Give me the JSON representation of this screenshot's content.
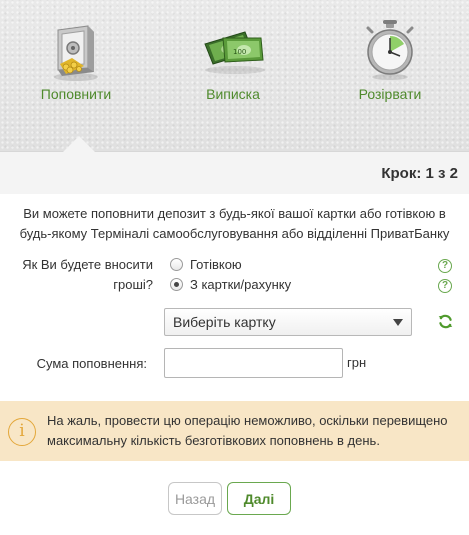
{
  "actions": [
    {
      "label": "Поповнити",
      "icon": "safe-icon"
    },
    {
      "label": "Виписка",
      "icon": "money-icon"
    },
    {
      "label": "Розірвати",
      "icon": "stopwatch-icon"
    }
  ],
  "step": "Крок: 1 з 2",
  "intro_text": "Ви можете поповнити депозит з будь-якої вашої картки або готівкою в будь-якому Терміналі самообслуговування або відділенні ПриватБанку",
  "payment": {
    "question": "Як Ви будете вносити гроші?",
    "options": [
      {
        "label": "Готівкою",
        "checked": false
      },
      {
        "label": "З картки/рахунку",
        "checked": true
      }
    ],
    "help_glyph": "?"
  },
  "card_select": {
    "selected": "Виберіть картку"
  },
  "amount": {
    "label": "Сума поповнення:",
    "value": "",
    "unit": "грн"
  },
  "warning": {
    "icon": "info-icon",
    "glyph": "i",
    "text": "На жаль, провести цю операцію неможливо, оскільки перевищено максимальну кількість безготівкових поповнень в день."
  },
  "buttons": {
    "back": "Назад",
    "next": "Далі"
  },
  "colors": {
    "accent_green": "#4f8a2c",
    "warning_bg": "#f8e6c6",
    "warning_icon": "#e3a73a"
  }
}
